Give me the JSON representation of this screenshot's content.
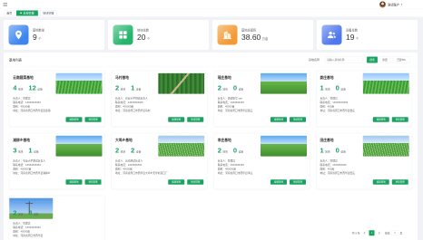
{
  "topbar": {
    "menu_icon": "menu-icon",
    "user_name": "测试账户",
    "avatar_icon": "avatar",
    "caret_icon": "caret-down-icon"
  },
  "tabs": [
    {
      "label": "首页",
      "active": false
    },
    {
      "label": "基地管理",
      "active": true
    },
    {
      "label": "地块管理",
      "active": false
    }
  ],
  "colors": {
    "accent": "#1aa260",
    "page_bg": "#f0f2f5"
  },
  "stats": [
    {
      "label": "基地数量",
      "value": "9",
      "unit": "个",
      "icon": "location-pin-icon",
      "color": "#3d86f0"
    },
    {
      "label": "地块总数",
      "value": "20",
      "unit": "个",
      "icon": "grid-icon",
      "color": "#25b56c"
    },
    {
      "label": "基地总面积",
      "value": "38.60",
      "unit": "万亩",
      "icon": "building-icon",
      "color": "#f39a34"
    },
    {
      "label": "设备总数",
      "value": "19",
      "unit": "个",
      "icon": "users-icon",
      "color": "#4f78ec"
    }
  ],
  "panel": {
    "title": "基地列表",
    "search": {
      "label": "基地名称",
      "placeholder": "请输入基地名称",
      "value": ""
    },
    "buttons": {
      "search": "搜索",
      "reset": "重置",
      "extra": "已建5/9"
    }
  },
  "bases": {
    "plots_label": "地块",
    "devices_label": "设备",
    "manager_label": "负责人：",
    "phone_label": "联系电话：",
    "area_label": "面积：",
    "address_label": "地址：",
    "edit_label": "编辑基地",
    "manage_label": "地块管理",
    "list": [
      {
        "name": "云南蔬菜基地",
        "plots": "4",
        "devices": "12",
        "manager": "管理员",
        "phone": "13333333333",
        "area": "40000亩",
        "address": "河南省周口市西华县逍遥镇"
      },
      {
        "name": "马村基地",
        "plots": "2",
        "devices": "1",
        "manager": "农业大学测试负责人",
        "phone": "13333333333",
        "area": "400000亩",
        "address": "河南省周口市西华县马村"
      },
      {
        "name": "瑶庄基地",
        "plots": "2",
        "devices": "0",
        "manager": "测试账号 yan",
        "phone": "1333333333",
        "area": "40000亩",
        "address": "河南省周口市西华县瑶庄"
      },
      {
        "name": "娄庄基地",
        "plots": "1",
        "devices": "0",
        "manager": "管理员",
        "phone": "13333333333",
        "area": "400亩",
        "address": "河南省周口市西华县娄庄"
      },
      {
        "name": "湖柳乡基地",
        "plots": "3",
        "devices": "1",
        "manager": "农业大学测试负责人",
        "phone": "13333333333",
        "area": "400000亩",
        "address": "河南省周口市西华县湖柳乡"
      },
      {
        "name": "大埠乡基地",
        "plots": "2",
        "devices": "2",
        "manager": "云南测试负责人",
        "phone": "1333333333",
        "area": "40000亩",
        "address": "河南省周口市西华县大埠乡天华村道口厂"
      },
      {
        "name": "李庄基地",
        "plots": "2",
        "devices": "0",
        "manager": "管理员",
        "phone": "1333333333",
        "area": "400000亩",
        "address": "河南省周口市西华县李庄"
      },
      {
        "name": "田庄基地",
        "plots": "1",
        "devices": "0",
        "manager": "管理员",
        "phone": "1333333333",
        "area": "400亩",
        "address": "河南省周口市西华县田庄"
      },
      {
        "name": "云南测试基地",
        "plots": "2",
        "devices": "4",
        "manager": "管理员",
        "phone": "13333333333",
        "area": "40000亩",
        "address": "河南省周口市西华县"
      }
    ]
  },
  "pagination": {
    "total_text": "共 9 条",
    "current": "1",
    "goto_label": "前往",
    "goto_value": "1",
    "page_suffix": "页"
  }
}
